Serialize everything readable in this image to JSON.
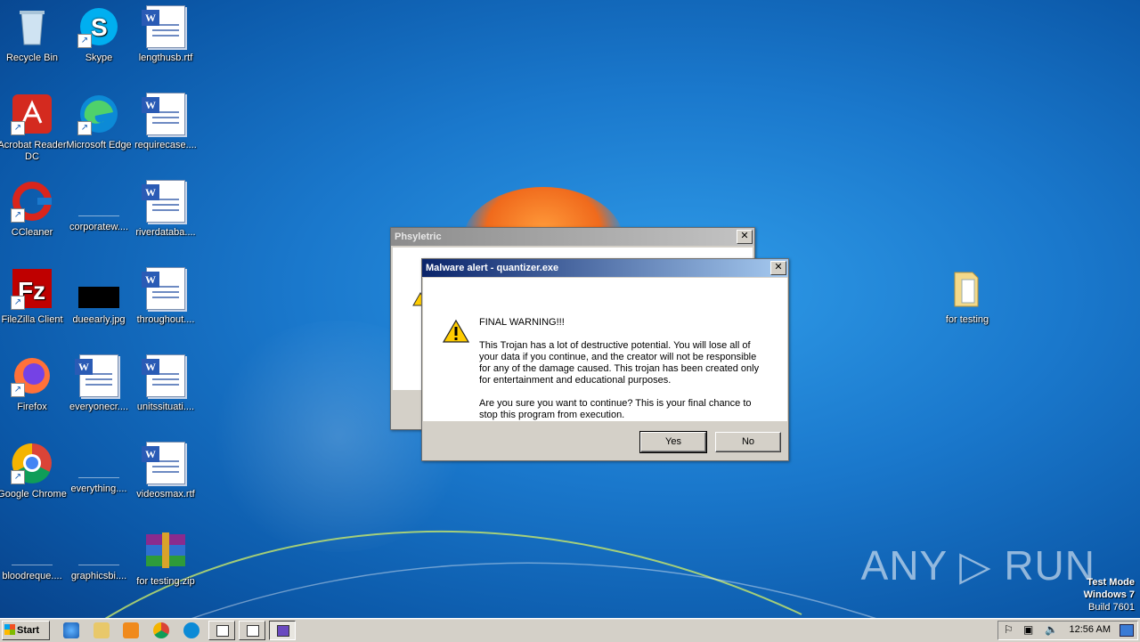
{
  "desktop": {
    "icons": [
      {
        "label": "Recycle Bin",
        "icon": "recycle-bin-icon"
      },
      {
        "label": "Skype",
        "icon": "skype-icon"
      },
      {
        "label": "lengthusb.rtf",
        "icon": "word-document-icon"
      },
      {
        "label": "Acrobat Reader DC",
        "icon": "acrobat-icon"
      },
      {
        "label": "Microsoft Edge",
        "icon": "edge-icon"
      },
      {
        "label": "requirecase....",
        "icon": "word-document-icon"
      },
      {
        "label": "CCleaner",
        "icon": "ccleaner-icon"
      },
      {
        "label": "corporatew....",
        "icon": "blank-file-icon"
      },
      {
        "label": "riverdataba....",
        "icon": "word-document-icon"
      },
      {
        "label": "FileZilla Client",
        "icon": "filezilla-icon"
      },
      {
        "label": "dueearly.jpg",
        "icon": "image-file-icon"
      },
      {
        "label": "throughout....",
        "icon": "word-document-icon"
      },
      {
        "label": "Firefox",
        "icon": "firefox-icon"
      },
      {
        "label": "everyonecr....",
        "icon": "word-document-icon"
      },
      {
        "label": "unitssituati....",
        "icon": "word-document-icon"
      },
      {
        "label": "Google Chrome",
        "icon": "chrome-icon"
      },
      {
        "label": "everything....",
        "icon": "blank-file-icon"
      },
      {
        "label": "videosmax.rtf",
        "icon": "word-document-icon"
      },
      {
        "label": "bloodreque....",
        "icon": "blank-file-icon"
      },
      {
        "label": "graphicsbi....",
        "icon": "blank-file-icon"
      },
      {
        "label": "for testing.zip",
        "icon": "winrar-archive-icon"
      },
      {
        "label": "for testing",
        "icon": "folder-icon"
      }
    ]
  },
  "background_window": {
    "title": "Phsyletric",
    "close": "✕"
  },
  "dialog": {
    "title": "Malware alert - quantizer.exe",
    "close": "✕",
    "heading": "FINAL WARNING!!!",
    "paragraph1": "This Trojan has a lot of destructive potential. You will lose all of your data if you continue, and the creator will not be responsible for any of the damage caused. This trojan has been created only for entertainment and educational purposes.",
    "paragraph2": "Are you sure you want to continue? This is your final chance to stop this program from execution.",
    "yes_label": "Yes",
    "no_label": "No"
  },
  "taskbar": {
    "start_label": "Start",
    "clock": "12:56 AM"
  },
  "watermark": "ANY ▷ RUN",
  "test_mode": {
    "line1": "Test Mode",
    "line2": "Windows 7",
    "line3": "Build 7601"
  },
  "colors": {
    "titlebar_active_start": "#0a246a",
    "titlebar_active_end": "#a6caf0",
    "desktop_blue": "#1a78cc"
  }
}
